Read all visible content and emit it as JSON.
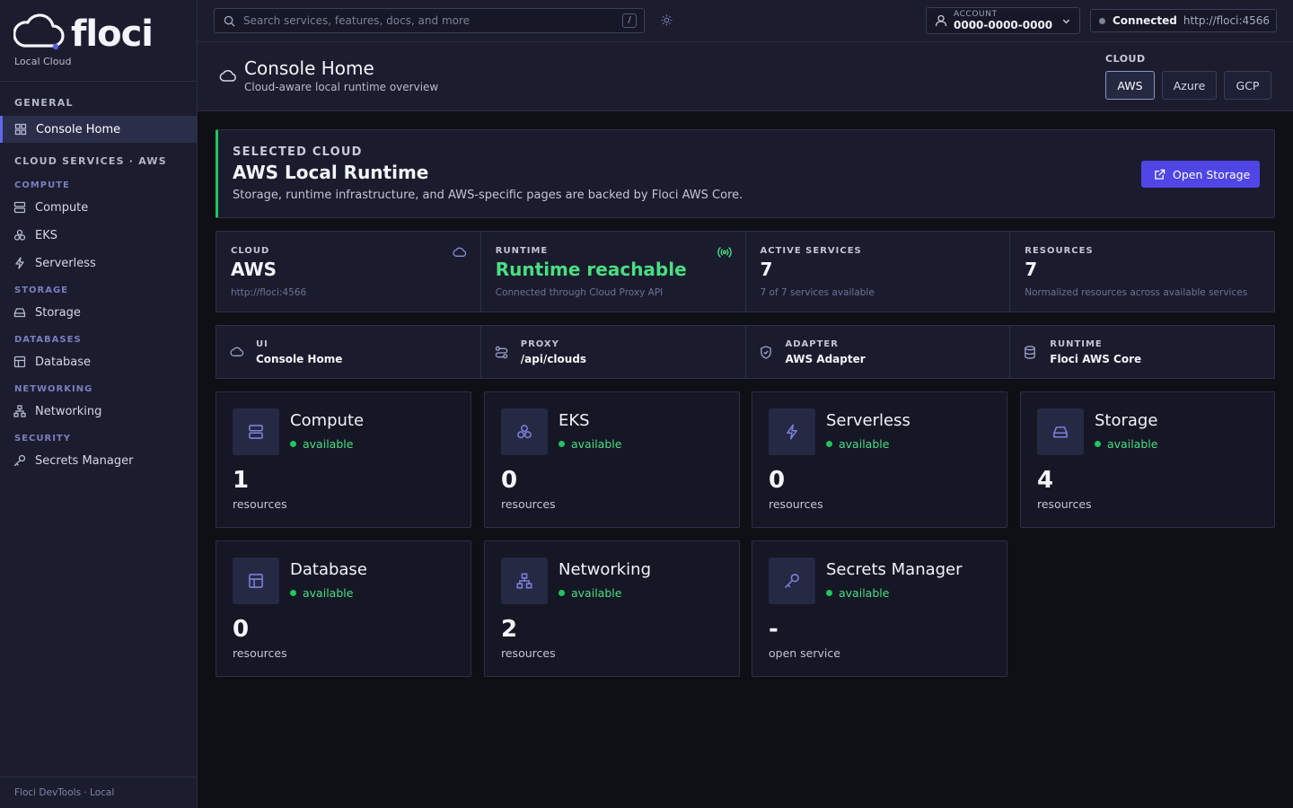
{
  "brand": {
    "name": "floci",
    "subtitle": "Local Cloud"
  },
  "sidebar": {
    "general_title": "GENERAL",
    "home_label": "Console Home",
    "services_title": "CLOUD SERVICES · AWS",
    "groups": {
      "compute": "COMPUTE",
      "storage": "STORAGE",
      "databases": "DATABASES",
      "networking": "NETWORKING",
      "security": "SECURITY"
    },
    "items": {
      "compute": "Compute",
      "eks": "EKS",
      "serverless": "Serverless",
      "storage": "Storage",
      "database": "Database",
      "networking": "Networking",
      "secrets": "Secrets Manager"
    },
    "footer": "Floci DevTools · Local"
  },
  "topbar": {
    "search_placeholder": "Search services, features, docs, and more",
    "search_shortcut": "/",
    "account_label": "ACCOUNT",
    "account_id": "0000-0000-0000",
    "connection_status": "Connected",
    "connection_url": "http://floci:4566"
  },
  "header": {
    "title": "Console Home",
    "subtitle": "Cloud-aware local runtime overview",
    "cloud_label": "CLOUD",
    "clouds": [
      "AWS",
      "Azure",
      "GCP"
    ],
    "selected_cloud": "AWS"
  },
  "banner": {
    "eyebrow": "SELECTED CLOUD",
    "title": "AWS Local Runtime",
    "description": "Storage, runtime infrastructure, and AWS-specific pages are backed by Floci AWS Core.",
    "button": "Open Storage"
  },
  "stats": [
    {
      "key": "CLOUD",
      "value": "AWS",
      "note": "http://floci:4566"
    },
    {
      "key": "RUNTIME",
      "value": "Runtime reachable",
      "note": "Connected through Cloud Proxy API"
    },
    {
      "key": "ACTIVE SERVICES",
      "value": "7",
      "note": "7 of 7 services available"
    },
    {
      "key": "RESOURCES",
      "value": "7",
      "note": "Normalized resources across available services"
    }
  ],
  "paths": [
    {
      "key": "UI",
      "value": "Console Home"
    },
    {
      "key": "PROXY",
      "value": "/api/clouds"
    },
    {
      "key": "ADAPTER",
      "value": "AWS Adapter"
    },
    {
      "key": "RUNTIME",
      "value": "Floci AWS Core"
    }
  ],
  "services": [
    {
      "name": "Compute",
      "status": "available",
      "count": "1",
      "unit": "resources"
    },
    {
      "name": "EKS",
      "status": "available",
      "count": "0",
      "unit": "resources"
    },
    {
      "name": "Serverless",
      "status": "available",
      "count": "0",
      "unit": "resources"
    },
    {
      "name": "Storage",
      "status": "available",
      "count": "4",
      "unit": "resources"
    },
    {
      "name": "Database",
      "status": "available",
      "count": "0",
      "unit": "resources"
    },
    {
      "name": "Networking",
      "status": "available",
      "count": "2",
      "unit": "resources"
    },
    {
      "name": "Secrets Manager",
      "status": "available",
      "count": "-",
      "unit": "open service"
    }
  ],
  "colors": {
    "accent": "#4f46e5",
    "success": "#22c55e",
    "background": "#0f0f16",
    "panel": "#1b1d2e"
  }
}
